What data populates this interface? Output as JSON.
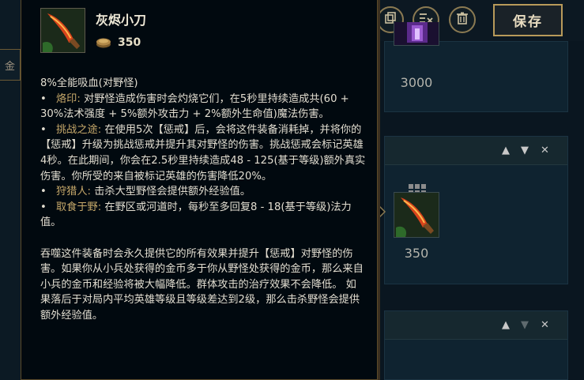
{
  "left_tab_label": "金",
  "toolbar": {
    "copy_icon": "copy-icon",
    "clear_icon": "clear-list-icon",
    "delete_icon": "trash-icon",
    "save_label": "保存"
  },
  "panels": [
    {
      "cost": "3000"
    },
    {
      "cost": "350",
      "controls": [
        "up-icon",
        "down-icon",
        "close-icon"
      ]
    },
    {
      "controls": [
        "up-icon",
        "down-icon",
        "close-icon"
      ]
    }
  ],
  "tooltip": {
    "title": "灰烬小刀",
    "gold": "350",
    "lines": {
      "l0": "8%全能吸血(对野怪)",
      "b1_name": "烙印:",
      "b1_text": " 对野怪造成伤害时会灼烧它们，在5秒里持续造成共(60 + 30%法术强度 + 5%额外攻击力 + 2%额外生命值)魔法伤害。",
      "b2_name": "挑战之途:",
      "b2_text": " 在使用5次【惩戒】后，会将这件装备消耗掉，并将你的【惩戒】升级为挑战惩戒并提升其对野怪的伤害。挑战惩戒会标记英雄4秒。在此期间，你会在2.5秒里持续造成48 - 125(基于等级)额外真实伤害。你所受的来自被标记英雄的伤害降低20%。",
      "b3_name": "狩猎人:",
      "b3_text": " 击杀大型野怪会提供额外经验值。",
      "b4_name": "取食于野:",
      "b4_text": " 在野区或河道时，每秒至多回复8 - 18(基于等级)法力值。",
      "para": "吞噬这件装备时会永久提供它的所有效果并提升【惩戒】对野怪的伤害。如果你从小兵处获得的金币多于你从野怪处获得的金币，那么来自小兵的金币和经验将被大幅降低。群体攻击的治疗效果不会降低。 如果落后于对局内平均英雄等级且等级差达到2级，那么击杀野怪会提供额外经验值。"
    }
  },
  "colors": {
    "accent_gold": "#c6a86a",
    "border_gold": "#b89a5a",
    "background": "#0a1620"
  }
}
